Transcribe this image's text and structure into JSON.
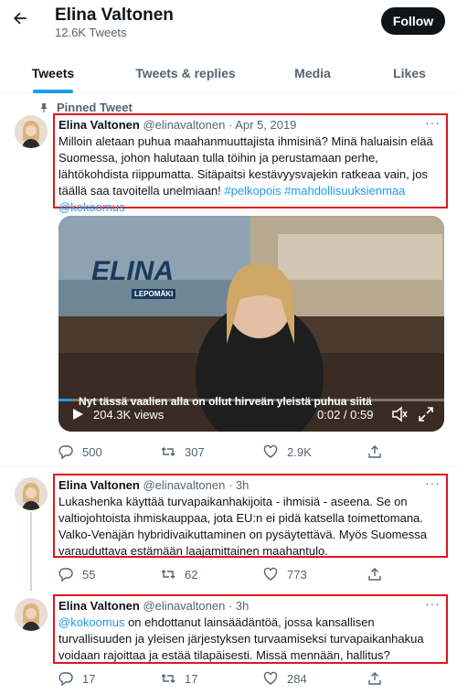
{
  "header": {
    "name": "Elina Valtonen",
    "tweet_count": "12.6K Tweets",
    "follow_label": "Follow"
  },
  "tabs": [
    {
      "label": "Tweets",
      "active": true
    },
    {
      "label": "Tweets & replies",
      "active": false
    },
    {
      "label": "Media",
      "active": false
    },
    {
      "label": "Likes",
      "active": false
    }
  ],
  "pinned_label": "Pinned Tweet",
  "tweets": [
    {
      "name": "Elina Valtonen",
      "handle": "@elinavaltonen",
      "sep": "·",
      "date": "Apr 5, 2019",
      "text": "Milloin aletaan puhua maahanmuuttajista ihmisinä? Minä haluaisin elää Suomessa, johon halutaan tulla töihin ja perustamaan perhe, lähtökohdista riippumatta. Sitäpaitsi kestävyysvajekin ratkeaa vain, jos täällä saa tavoitella unelmiaan!",
      "hashtags": "#pelkopois #mahdollisuuksienmaa",
      "mention": "@kokoomus",
      "video": {
        "logo_main": "ELINA",
        "logo_sub": "LEPOMÄKI",
        "caption": "Nyt tässä vaalien alla on ollut hirveän yleistä puhua siitä",
        "views": "204.3K views",
        "time": "0:02 / 0:59",
        "progress_fraction": 0.034
      },
      "replies": "500",
      "retweets": "307",
      "likes": "2.9K"
    },
    {
      "name": "Elina Valtonen",
      "handle": "@elinavaltonen",
      "sep": "·",
      "date": "3h",
      "text": "Lukashenka käyttää turvapaikanhakijoita - ihmisiä - aseena. Se on valtiojohtoista ihmiskauppaa, jota EU:n ei pidä katsella toimettomana. Valko-Venäjän hybridivaikuttaminen on pysäytettävä. Myös Suomessa varauduttava estämään laajamittainen maahantulo.",
      "replies": "55",
      "retweets": "62",
      "likes": "773"
    },
    {
      "name": "Elina Valtonen",
      "handle": "@elinavaltonen",
      "sep": "·",
      "date": "3h",
      "mention": "@kokoomus",
      "text": " on ehdottanut lainsäädäntöä, jossa kansallisen turvallisuuden ja yleisen järjestyksen turvaamiseksi turvapaikanhakua voidaan rajoittaa ja estää tilapäisesti. Missä mennään, hallitus?",
      "replies": "17",
      "retweets": "17",
      "likes": "284"
    }
  ],
  "colors": {
    "accent": "#1d9bf0",
    "highlight_box": "#e0141e",
    "text_secondary": "#536471"
  }
}
